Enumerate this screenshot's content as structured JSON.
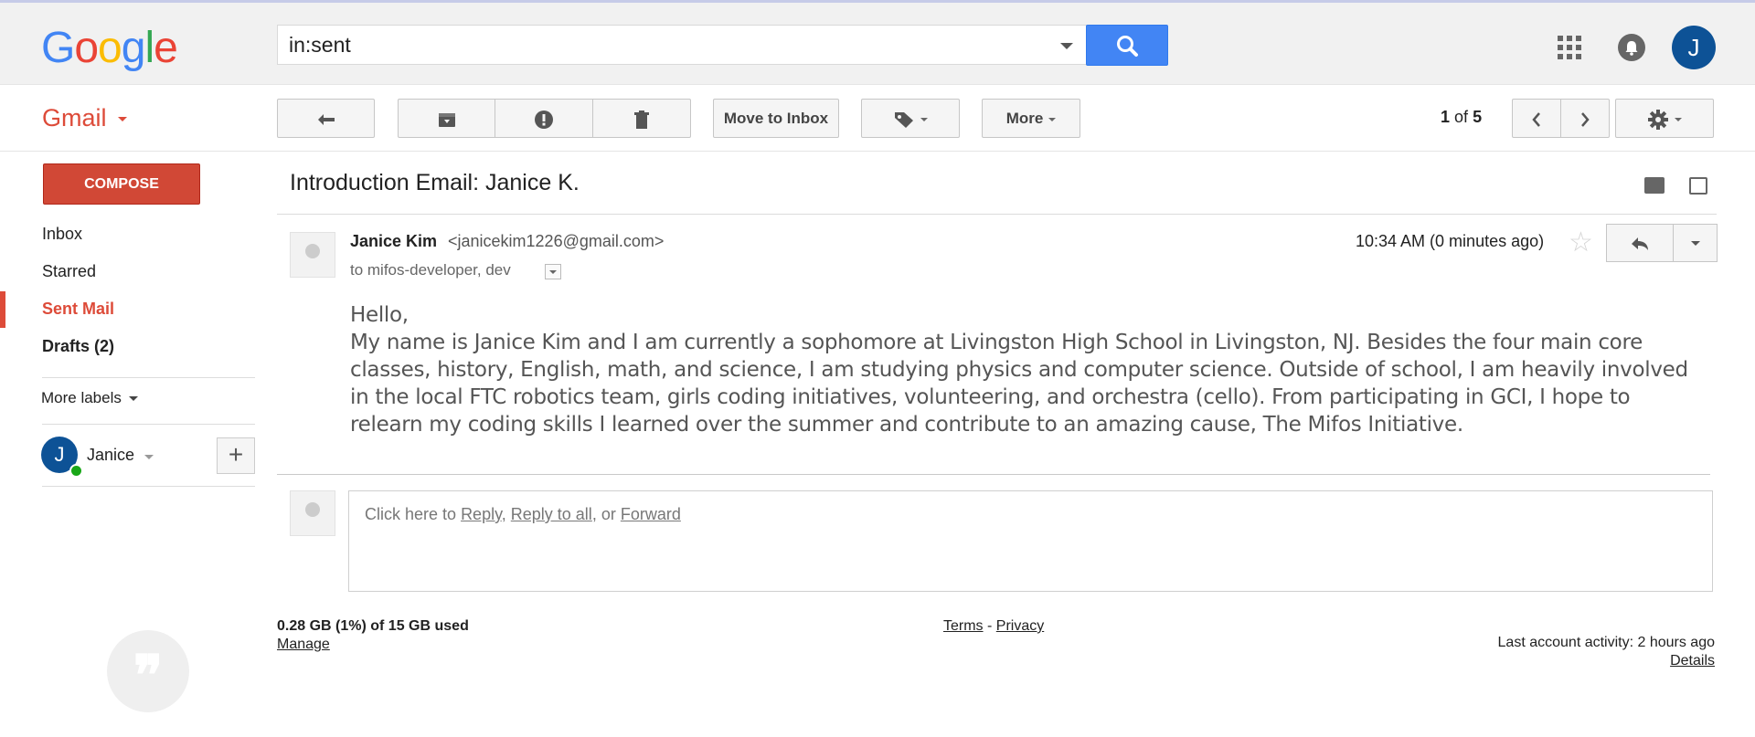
{
  "search": {
    "query": "in:sent"
  },
  "header": {
    "logo": [
      "G",
      "o",
      "o",
      "g",
      "l",
      "e"
    ],
    "logo_colors": [
      "#4285f4",
      "#ea4335",
      "#fbbc05",
      "#4285f4",
      "#34a853",
      "#ea4335"
    ],
    "avatar_letter": "J",
    "avatar_color": "#0d5296"
  },
  "toolbar": {
    "gmail_label": "Gmail",
    "move_to_inbox": "Move to Inbox",
    "more": "More",
    "pager_current": "1",
    "pager_of": "of",
    "pager_total": "5"
  },
  "sidebar": {
    "compose": "COMPOSE",
    "items": [
      {
        "label": "Inbox"
      },
      {
        "label": "Starred"
      },
      {
        "label": "Sent Mail"
      },
      {
        "label": "Drafts (2)"
      }
    ],
    "more_labels": "More labels",
    "account_letter": "J",
    "account_name": "Janice"
  },
  "message": {
    "subject": "Introduction Email: Janice K.",
    "sender_name": "Janice Kim",
    "sender_email": "<janicekim1226@gmail.com>",
    "to": "to mifos-developer, dev",
    "time": "10:34 AM (0 minutes ago)",
    "greeting": "Hello,",
    "body": "My name is Janice Kim and I am currently a sophomore at Livingston High School in Livingston, NJ. Besides the four main core classes, history, English, math, and science, I am studying physics and computer science. Outside of school, I am heavily involved in the local FTC robotics team, girls coding initiatives, volunteering, and orchestra (cello). From participating in GCI, I hope to relearn my coding skills I learned over the summer and contribute to an amazing cause, The Mifos Initiative."
  },
  "reply": {
    "prefix": "Click here to",
    "reply": "Reply",
    "reply_all": "Reply to all",
    "or": ", or",
    "forward": "Forward"
  },
  "footer": {
    "storage": "0.28 GB (1%) of 15 GB used",
    "manage": "Manage",
    "terms": "Terms",
    "dash": "-",
    "privacy": "Privacy",
    "activity": "Last account activity: 2 hours ago",
    "details": "Details"
  },
  "colors": {
    "accent_red": "#dd4b39",
    "compose_red": "#d14836",
    "search_blue": "#4285f4",
    "online_green": "#19a718"
  }
}
